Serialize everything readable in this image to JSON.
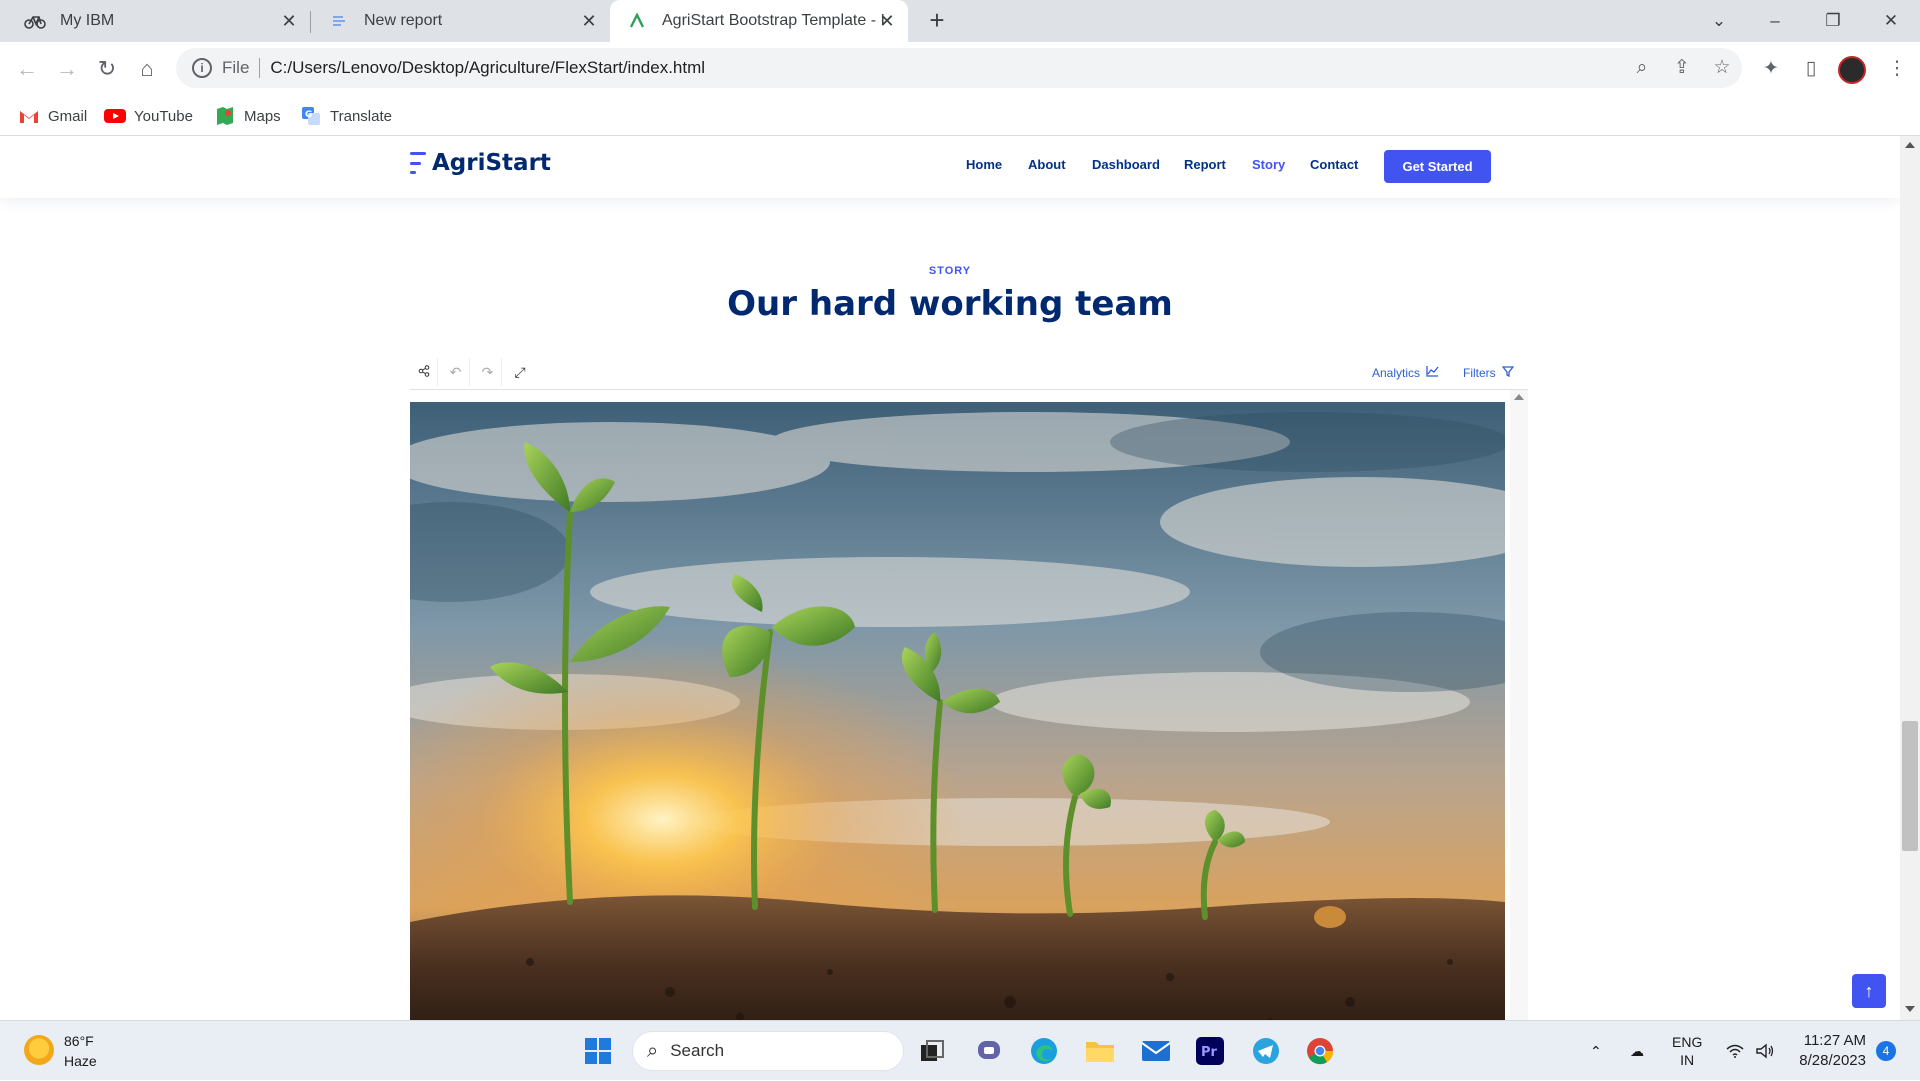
{
  "browser": {
    "tabs": [
      {
        "title": "My IBM",
        "icon": "ibm-bike-icon"
      },
      {
        "title": "New report",
        "icon": "report-icon"
      },
      {
        "title": "AgriStart Bootstrap Template - In",
        "icon": "agristart-icon",
        "active": true
      }
    ],
    "new_tab": "+",
    "omnibox": {
      "scheme_label": "File",
      "url": "C:/Users/Lenovo/Desktop/Agriculture/FlexStart/index.html"
    },
    "bookmarks": [
      {
        "label": "Gmail",
        "icon": "gmail-icon",
        "color": "#ea4335"
      },
      {
        "label": "YouTube",
        "icon": "youtube-icon",
        "color": "#ff0000"
      },
      {
        "label": "Maps",
        "icon": "maps-icon",
        "color": "#34a853"
      },
      {
        "label": "Translate",
        "icon": "translate-icon",
        "color": "#4285f4"
      }
    ]
  },
  "site": {
    "logo": "AgriStart",
    "nav": [
      {
        "label": "Home"
      },
      {
        "label": "About"
      },
      {
        "label": "Dashboard"
      },
      {
        "label": "Report"
      },
      {
        "label": "Story",
        "active": true
      },
      {
        "label": "Contact"
      }
    ],
    "cta": "Get Started",
    "accent": "#4154f1",
    "heading_color": "#012970"
  },
  "section": {
    "subtitle": "STORY",
    "title": "Our hard working team"
  },
  "report": {
    "toolbar_left": [
      "share-icon",
      "undo-icon",
      "redo-icon",
      "expand-icon"
    ],
    "analytics": "Analytics",
    "filters": "Filters"
  },
  "taskbar": {
    "weather": {
      "temp": "86°F",
      "condition": "Haze"
    },
    "search_placeholder": "Search",
    "tray": {
      "lang": "ENG",
      "region": "IN",
      "time": "11:27 AM",
      "date": "8/28/2023",
      "notifications": "4"
    }
  }
}
